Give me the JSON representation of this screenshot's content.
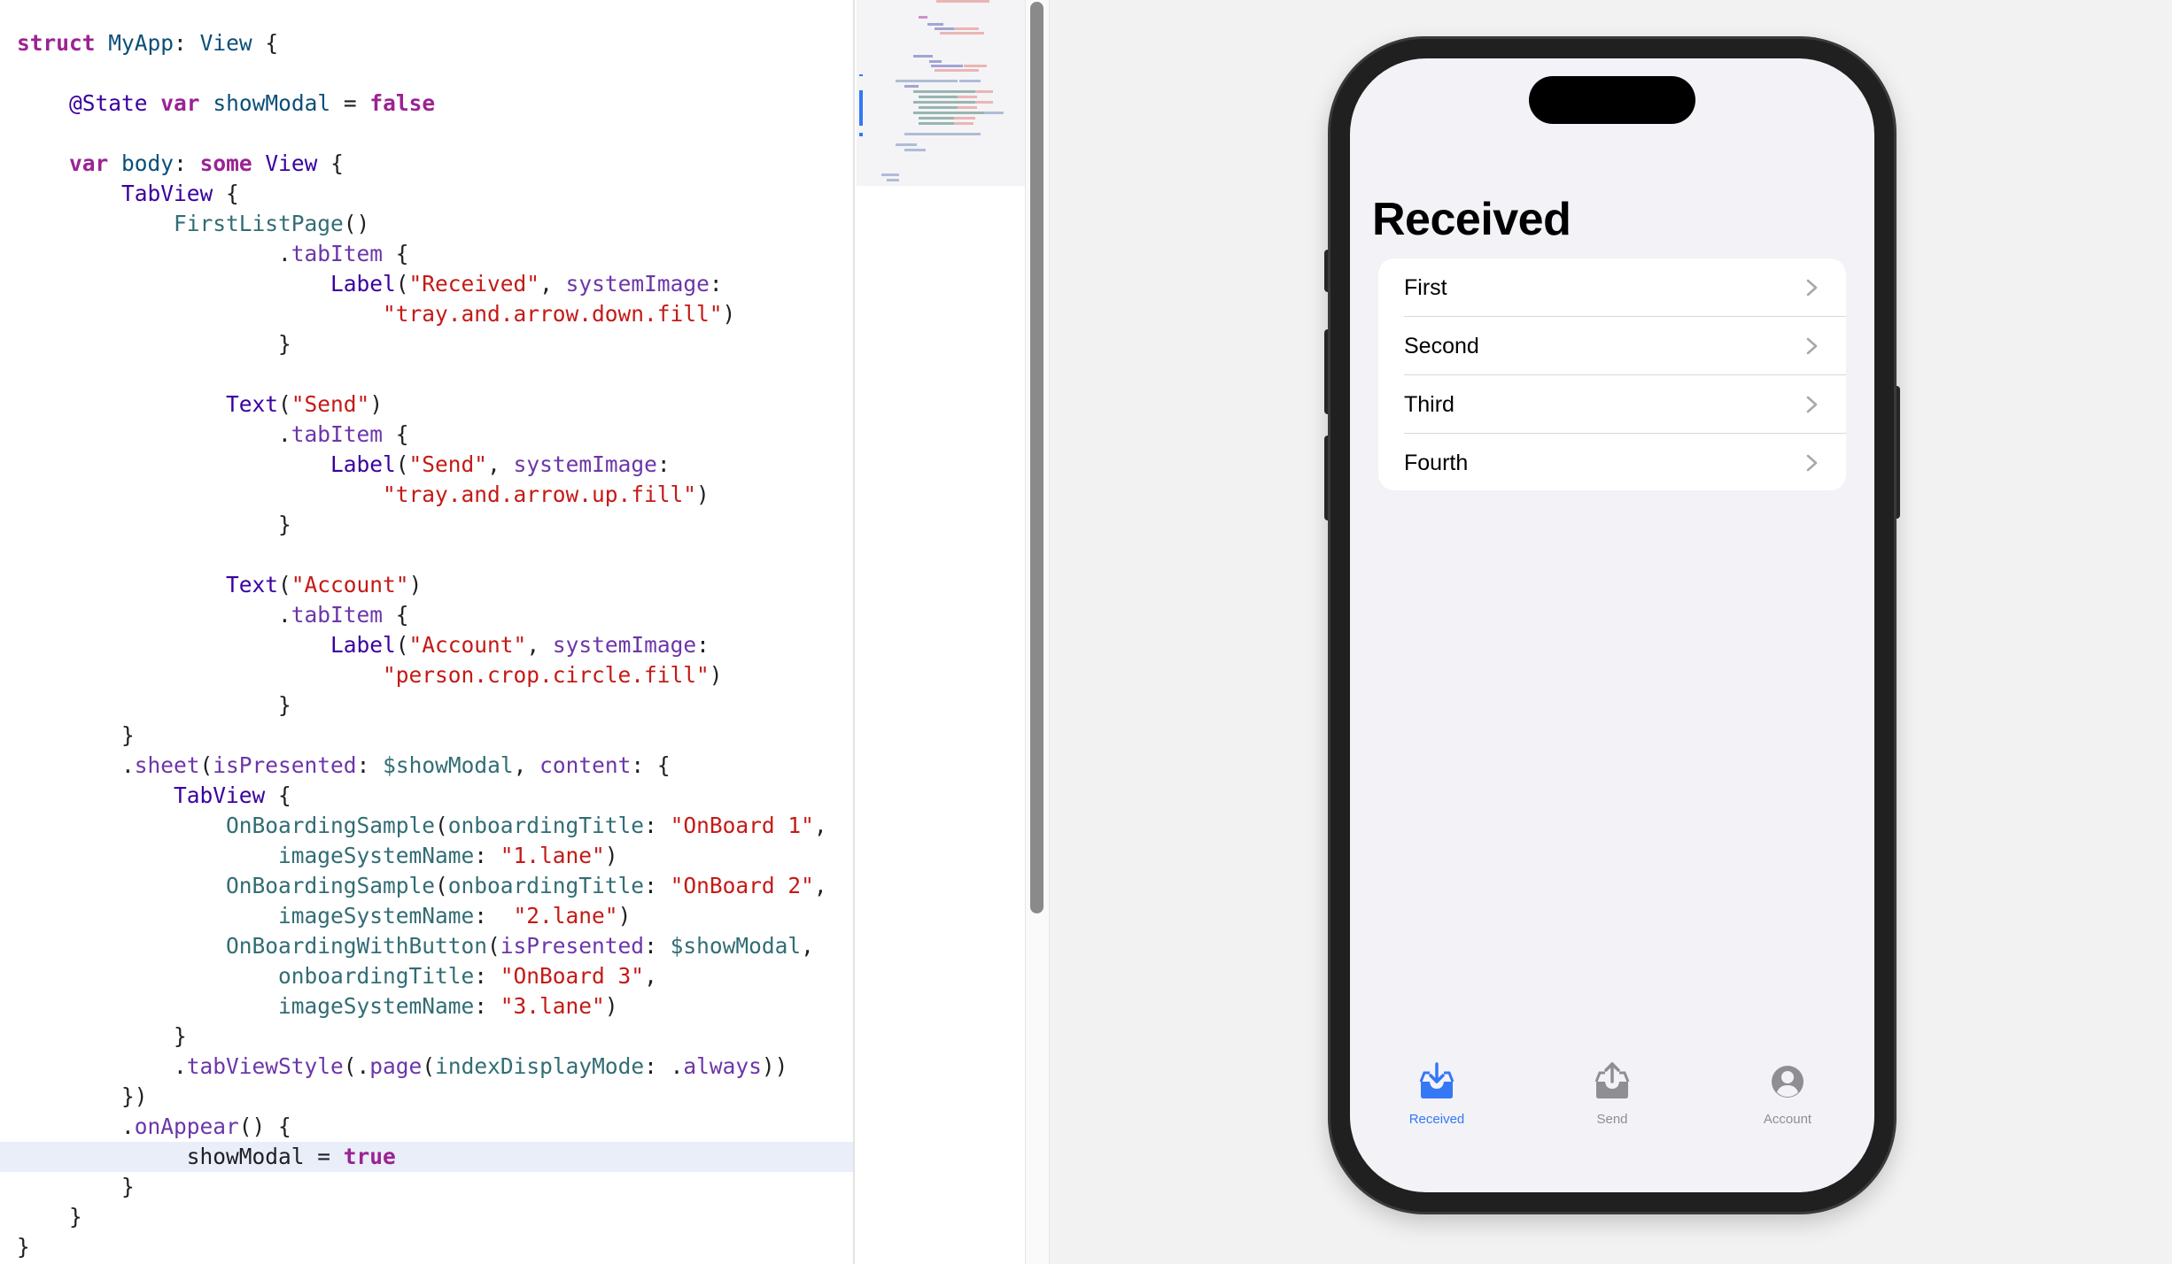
{
  "editor": {
    "lines": [
      [
        {
          "t": "struct",
          "c": "kw"
        },
        {
          "t": " ",
          "c": "pl"
        },
        {
          "t": "MyApp",
          "c": "ty2"
        },
        {
          "t": ": ",
          "c": "pl"
        },
        {
          "t": "View",
          "c": "ty2"
        },
        {
          "t": " {",
          "c": "pl"
        }
      ],
      [],
      [
        {
          "t": "    ",
          "c": "pl"
        },
        {
          "t": "@State",
          "c": "ty"
        },
        {
          "t": " ",
          "c": "pl"
        },
        {
          "t": "var",
          "c": "kw"
        },
        {
          "t": " ",
          "c": "pl"
        },
        {
          "t": "showModal",
          "c": "ty2"
        },
        {
          "t": " = ",
          "c": "pl"
        },
        {
          "t": "false",
          "c": "kw"
        }
      ],
      [],
      [
        {
          "t": "    ",
          "c": "pl"
        },
        {
          "t": "var",
          "c": "kw"
        },
        {
          "t": " ",
          "c": "pl"
        },
        {
          "t": "body",
          "c": "ty2"
        },
        {
          "t": ": ",
          "c": "pl"
        },
        {
          "t": "some",
          "c": "kw"
        },
        {
          "t": " ",
          "c": "pl"
        },
        {
          "t": "View",
          "c": "ty"
        },
        {
          "t": " {",
          "c": "pl"
        }
      ],
      [
        {
          "t": "        ",
          "c": "pl"
        },
        {
          "t": "TabView",
          "c": "ty"
        },
        {
          "t": " {",
          "c": "pl"
        }
      ],
      [
        {
          "t": "            ",
          "c": "pl"
        },
        {
          "t": "FirstListPage",
          "c": "prop"
        },
        {
          "t": "()",
          "c": "pl"
        }
      ],
      [
        {
          "t": "                    .",
          "c": "pl"
        },
        {
          "t": "tabItem",
          "c": "meth"
        },
        {
          "t": " {",
          "c": "pl"
        }
      ],
      [
        {
          "t": "                        ",
          "c": "pl"
        },
        {
          "t": "Label",
          "c": "ty"
        },
        {
          "t": "(",
          "c": "pl"
        },
        {
          "t": "\"Received\"",
          "c": "str"
        },
        {
          "t": ", ",
          "c": "pl"
        },
        {
          "t": "systemImage",
          "c": "meth"
        },
        {
          "t": ":",
          "c": "pl"
        }
      ],
      [
        {
          "t": "                            ",
          "c": "pl"
        },
        {
          "t": "\"tray.and.arrow.down.fill\"",
          "c": "str"
        },
        {
          "t": ")",
          "c": "pl"
        }
      ],
      [
        {
          "t": "                    }",
          "c": "pl"
        }
      ],
      [],
      [
        {
          "t": "                ",
          "c": "pl"
        },
        {
          "t": "Text",
          "c": "ty"
        },
        {
          "t": "(",
          "c": "pl"
        },
        {
          "t": "\"Send\"",
          "c": "str"
        },
        {
          "t": ")",
          "c": "pl"
        }
      ],
      [
        {
          "t": "                    .",
          "c": "pl"
        },
        {
          "t": "tabItem",
          "c": "meth"
        },
        {
          "t": " {",
          "c": "pl"
        }
      ],
      [
        {
          "t": "                        ",
          "c": "pl"
        },
        {
          "t": "Label",
          "c": "ty"
        },
        {
          "t": "(",
          "c": "pl"
        },
        {
          "t": "\"Send\"",
          "c": "str"
        },
        {
          "t": ", ",
          "c": "pl"
        },
        {
          "t": "systemImage",
          "c": "meth"
        },
        {
          "t": ":",
          "c": "pl"
        }
      ],
      [
        {
          "t": "                            ",
          "c": "pl"
        },
        {
          "t": "\"tray.and.arrow.up.fill\"",
          "c": "str"
        },
        {
          "t": ")",
          "c": "pl"
        }
      ],
      [
        {
          "t": "                    }",
          "c": "pl"
        }
      ],
      [],
      [
        {
          "t": "                ",
          "c": "pl"
        },
        {
          "t": "Text",
          "c": "ty"
        },
        {
          "t": "(",
          "c": "pl"
        },
        {
          "t": "\"Account\"",
          "c": "str"
        },
        {
          "t": ")",
          "c": "pl"
        }
      ],
      [
        {
          "t": "                    .",
          "c": "pl"
        },
        {
          "t": "tabItem",
          "c": "meth"
        },
        {
          "t": " {",
          "c": "pl"
        }
      ],
      [
        {
          "t": "                        ",
          "c": "pl"
        },
        {
          "t": "Label",
          "c": "ty"
        },
        {
          "t": "(",
          "c": "pl"
        },
        {
          "t": "\"Account\"",
          "c": "str"
        },
        {
          "t": ", ",
          "c": "pl"
        },
        {
          "t": "systemImage",
          "c": "meth"
        },
        {
          "t": ":",
          "c": "pl"
        }
      ],
      [
        {
          "t": "                            ",
          "c": "pl"
        },
        {
          "t": "\"person.crop.circle.fill\"",
          "c": "str"
        },
        {
          "t": ")",
          "c": "pl"
        }
      ],
      [
        {
          "t": "                    }",
          "c": "pl"
        }
      ],
      [
        {
          "t": "        }",
          "c": "pl"
        }
      ],
      [
        {
          "t": "        .",
          "c": "pl"
        },
        {
          "t": "sheet",
          "c": "meth"
        },
        {
          "t": "(",
          "c": "pl"
        },
        {
          "t": "isPresented",
          "c": "meth"
        },
        {
          "t": ": ",
          "c": "pl"
        },
        {
          "t": "$showModal",
          "c": "prop"
        },
        {
          "t": ", ",
          "c": "pl"
        },
        {
          "t": "content",
          "c": "meth"
        },
        {
          "t": ": {",
          "c": "pl"
        }
      ],
      [
        {
          "t": "            ",
          "c": "pl"
        },
        {
          "t": "TabView",
          "c": "ty"
        },
        {
          "t": " {",
          "c": "pl"
        }
      ],
      [
        {
          "t": "                ",
          "c": "pl"
        },
        {
          "t": "OnBoardingSample",
          "c": "prop"
        },
        {
          "t": "(",
          "c": "pl"
        },
        {
          "t": "onboardingTitle",
          "c": "prop"
        },
        {
          "t": ": ",
          "c": "pl"
        },
        {
          "t": "\"OnBoard 1\"",
          "c": "str"
        },
        {
          "t": ",",
          "c": "pl"
        }
      ],
      [
        {
          "t": "                    ",
          "c": "pl"
        },
        {
          "t": "imageSystemName",
          "c": "prop"
        },
        {
          "t": ": ",
          "c": "pl"
        },
        {
          "t": "\"1.lane\"",
          "c": "str"
        },
        {
          "t": ")",
          "c": "pl"
        }
      ],
      [
        {
          "t": "                ",
          "c": "pl"
        },
        {
          "t": "OnBoardingSample",
          "c": "prop"
        },
        {
          "t": "(",
          "c": "pl"
        },
        {
          "t": "onboardingTitle",
          "c": "prop"
        },
        {
          "t": ": ",
          "c": "pl"
        },
        {
          "t": "\"OnBoard 2\"",
          "c": "str"
        },
        {
          "t": ",",
          "c": "pl"
        }
      ],
      [
        {
          "t": "                    ",
          "c": "pl"
        },
        {
          "t": "imageSystemName",
          "c": "prop"
        },
        {
          "t": ":  ",
          "c": "pl"
        },
        {
          "t": "\"2.lane\"",
          "c": "str"
        },
        {
          "t": ")",
          "c": "pl"
        }
      ],
      [
        {
          "t": "                ",
          "c": "pl"
        },
        {
          "t": "OnBoardingWithButton",
          "c": "prop"
        },
        {
          "t": "(",
          "c": "pl"
        },
        {
          "t": "isPresented",
          "c": "meth"
        },
        {
          "t": ": ",
          "c": "pl"
        },
        {
          "t": "$showModal",
          "c": "prop"
        },
        {
          "t": ",",
          "c": "pl"
        }
      ],
      [
        {
          "t": "                    ",
          "c": "pl"
        },
        {
          "t": "onboardingTitle",
          "c": "prop"
        },
        {
          "t": ": ",
          "c": "pl"
        },
        {
          "t": "\"OnBoard 3\"",
          "c": "str"
        },
        {
          "t": ",",
          "c": "pl"
        }
      ],
      [
        {
          "t": "                    ",
          "c": "pl"
        },
        {
          "t": "imageSystemName",
          "c": "prop"
        },
        {
          "t": ": ",
          "c": "pl"
        },
        {
          "t": "\"3.lane\"",
          "c": "str"
        },
        {
          "t": ")",
          "c": "pl"
        }
      ],
      [
        {
          "t": "            }",
          "c": "pl"
        }
      ],
      [
        {
          "t": "            .",
          "c": "pl"
        },
        {
          "t": "tabViewStyle",
          "c": "meth"
        },
        {
          "t": "(.",
          "c": "pl"
        },
        {
          "t": "page",
          "c": "meth"
        },
        {
          "t": "(",
          "c": "pl"
        },
        {
          "t": "indexDisplayMode",
          "c": "prop"
        },
        {
          "t": ": .",
          "c": "pl"
        },
        {
          "t": "always",
          "c": "meth"
        },
        {
          "t": "))",
          "c": "pl"
        }
      ],
      [
        {
          "t": "        })",
          "c": "pl"
        }
      ],
      [
        {
          "t": "        .",
          "c": "pl"
        },
        {
          "t": "onAppear",
          "c": "meth"
        },
        {
          "t": "() {",
          "c": "pl"
        }
      ],
      [
        {
          "t": "             showModal = ",
          "c": "pl"
        },
        {
          "t": "true",
          "c": "kw"
        }
      ],
      [
        {
          "t": "        }",
          "c": "pl"
        }
      ],
      [
        {
          "t": "    }",
          "c": "pl"
        }
      ],
      [
        {
          "t": "}",
          "c": "pl"
        }
      ]
    ],
    "current_line": 37
  },
  "preview": {
    "nav_title": "Received",
    "list_items": [
      "First",
      "Second",
      "Third",
      "Fourth"
    ],
    "tabs": [
      {
        "label": "Received",
        "icon": "tray-arrow-down-icon",
        "selected": true
      },
      {
        "label": "Send",
        "icon": "tray-arrow-up-icon",
        "selected": false
      },
      {
        "label": "Account",
        "icon": "person-crop-circle-icon",
        "selected": false
      }
    ]
  },
  "colors": {
    "accent": "#3478f6",
    "tab_inactive": "#8e8e93",
    "keyword": "#9b2393",
    "string": "#c41a16"
  }
}
